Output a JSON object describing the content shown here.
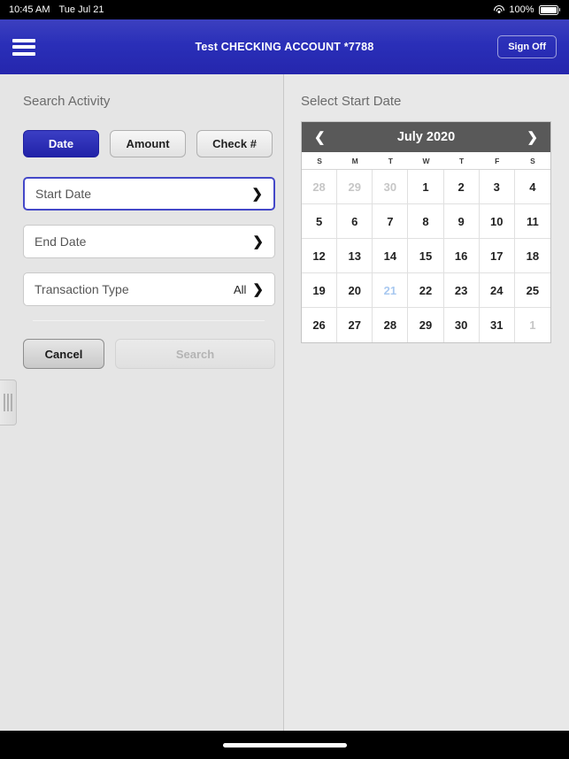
{
  "status_bar": {
    "time": "10:45 AM",
    "date": "Tue Jul 21",
    "wifi_icon": "wifi-icon",
    "battery_percent": "100%",
    "battery_icon": "battery-full-icon"
  },
  "nav_bar": {
    "menu_icon": "hamburger-menu-icon",
    "title": "Test CHECKING ACCOUNT *7788",
    "sign_off_label": "Sign Off"
  },
  "left_pane": {
    "heading": "Search Activity",
    "segmented": [
      {
        "label": "Date",
        "active": true
      },
      {
        "label": "Amount",
        "active": false
      },
      {
        "label": "Check #",
        "active": false
      }
    ],
    "fields": [
      {
        "label": "Start Date",
        "value": "",
        "focused": true,
        "chevron": "chevron-right-icon"
      },
      {
        "label": "End Date",
        "value": "",
        "focused": false,
        "chevron": "chevron-right-icon"
      },
      {
        "label": "Transaction Type",
        "value": "All",
        "focused": false,
        "chevron": "chevron-right-icon"
      }
    ],
    "cancel_label": "Cancel",
    "search_label": "Search",
    "search_disabled": true,
    "drag_handle_icon": "drag-handle-icon"
  },
  "right_pane": {
    "heading": "Select Start Date",
    "calendar": {
      "prev_icon": "chevron-left-icon",
      "next_icon": "chevron-right-icon",
      "month_label": "July 2020",
      "weekday_labels": [
        "S",
        "M",
        "T",
        "W",
        "T",
        "F",
        "S"
      ],
      "weeks": [
        [
          {
            "day": "28",
            "state": "muted"
          },
          {
            "day": "29",
            "state": "muted"
          },
          {
            "day": "30",
            "state": "muted"
          },
          {
            "day": "1",
            "state": "normal"
          },
          {
            "day": "2",
            "state": "normal"
          },
          {
            "day": "3",
            "state": "normal"
          },
          {
            "day": "4",
            "state": "normal"
          }
        ],
        [
          {
            "day": "5",
            "state": "normal"
          },
          {
            "day": "6",
            "state": "normal"
          },
          {
            "day": "7",
            "state": "normal"
          },
          {
            "day": "8",
            "state": "normal"
          },
          {
            "day": "9",
            "state": "normal"
          },
          {
            "day": "10",
            "state": "normal"
          },
          {
            "day": "11",
            "state": "normal"
          }
        ],
        [
          {
            "day": "12",
            "state": "normal"
          },
          {
            "day": "13",
            "state": "normal"
          },
          {
            "day": "14",
            "state": "normal"
          },
          {
            "day": "15",
            "state": "normal"
          },
          {
            "day": "16",
            "state": "normal"
          },
          {
            "day": "17",
            "state": "normal"
          },
          {
            "day": "18",
            "state": "normal"
          }
        ],
        [
          {
            "day": "19",
            "state": "normal"
          },
          {
            "day": "20",
            "state": "normal"
          },
          {
            "day": "21",
            "state": "today"
          },
          {
            "day": "22",
            "state": "normal"
          },
          {
            "day": "23",
            "state": "normal"
          },
          {
            "day": "24",
            "state": "normal"
          },
          {
            "day": "25",
            "state": "normal"
          }
        ],
        [
          {
            "day": "26",
            "state": "normal"
          },
          {
            "day": "27",
            "state": "normal"
          },
          {
            "day": "28",
            "state": "normal"
          },
          {
            "day": "29",
            "state": "normal"
          },
          {
            "day": "30",
            "state": "normal"
          },
          {
            "day": "31",
            "state": "normal"
          },
          {
            "day": "1",
            "state": "muted"
          }
        ]
      ]
    }
  },
  "colors": {
    "nav_bar_blue": "#2a2fb8",
    "active_segment_blue": "#2122a8",
    "focus_border_blue": "#4448c8",
    "calendar_header_gray": "#595959",
    "today_blue": "#a8c8f0",
    "pane_background": "#e5e5e5"
  },
  "home_indicator": "home-indicator"
}
